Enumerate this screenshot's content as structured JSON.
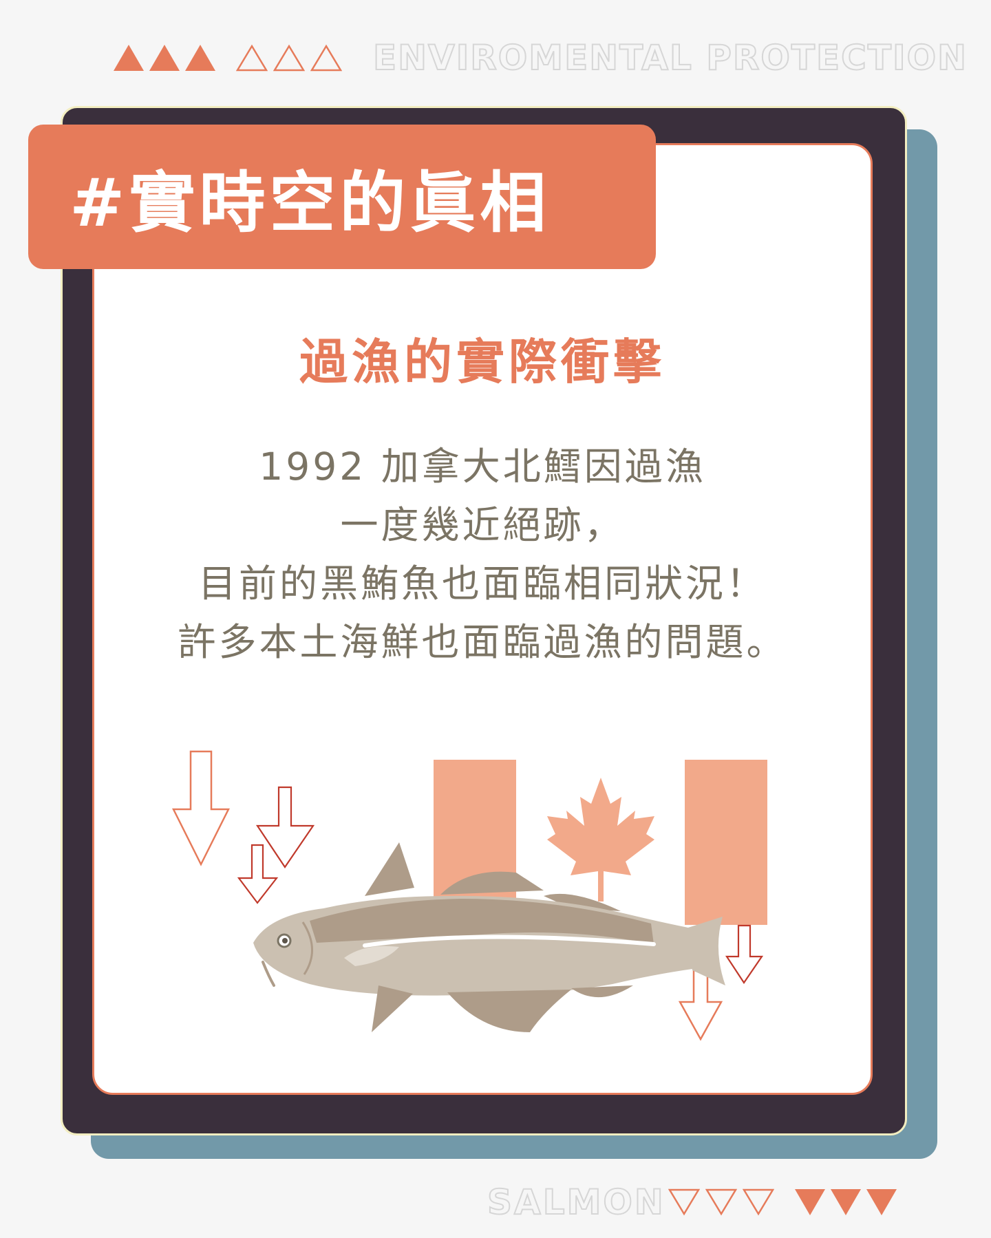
{
  "header": {
    "title": "ENVIROMENTAL PROTECTION",
    "triangles_solid_count": 3,
    "triangles_outline_count": 3
  },
  "footer": {
    "title": "SALMON",
    "triangles_outline_count": 3,
    "triangles_solid_count": 3
  },
  "card": {
    "tag": "#實時空的眞相",
    "heading": "過漁的實際衝擊",
    "body_lines": [
      "1992 加拿大北鱈因過漁",
      "一度幾近絕跡，",
      "目前的黑鮪魚也面臨相同狀況！",
      "許多本土海鮮也面臨過漁的問題。"
    ]
  },
  "illustration": {
    "items": [
      "canada-flag",
      "maple-leaf-icon",
      "cod-fish",
      "down-arrow-icon"
    ]
  },
  "colors": {
    "accent": "#e67b5a",
    "frame": "#3a2f3c",
    "shadow": "#7299a9",
    "text": "#7b7464",
    "flag": "#f2a98a",
    "fish_dark": "#ae9c89",
    "fish_light": "#cbc0b1"
  }
}
